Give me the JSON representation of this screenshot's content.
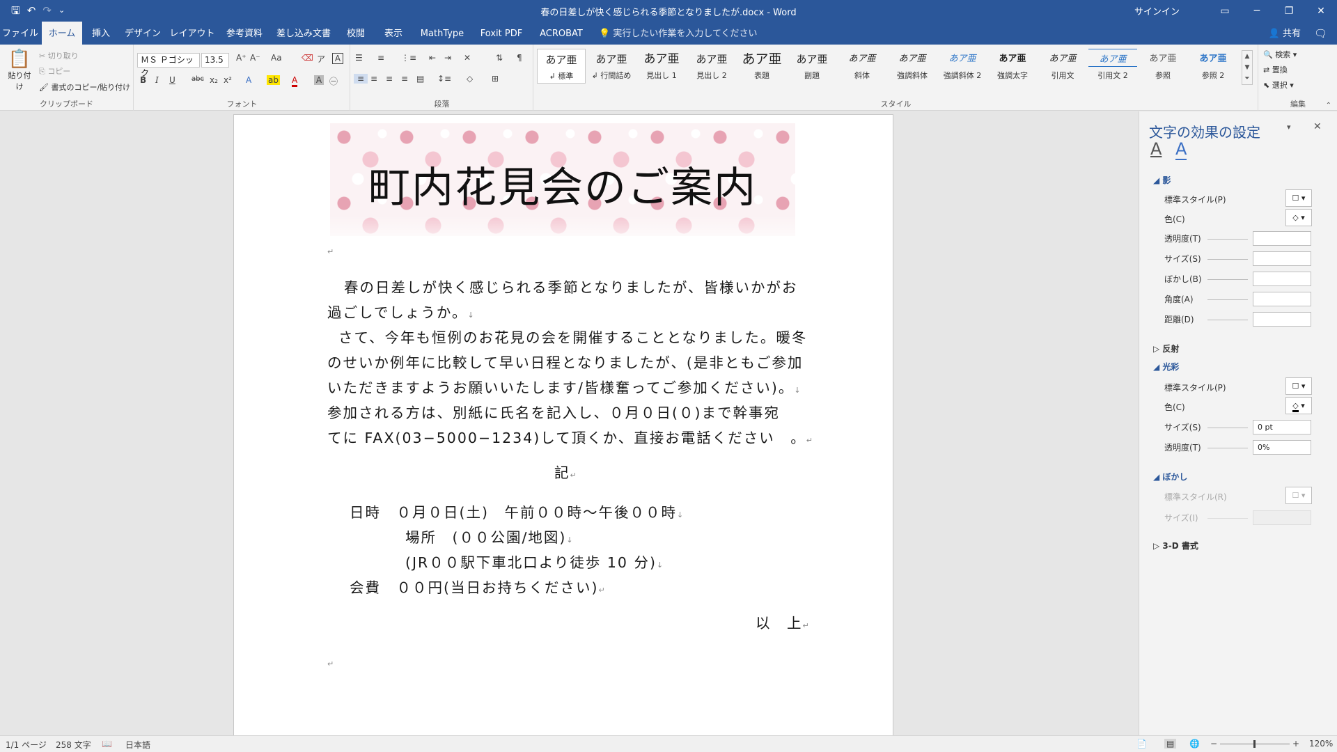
{
  "window": {
    "title": "春の日差しが快く感じられる季節となりましたが.docx  -  Word",
    "signin": "サインイン",
    "minimize": "─",
    "restore": "❐",
    "close": "✕"
  },
  "qat": {
    "save": "🖫",
    "undo": "↶",
    "redo": "↷",
    "customize": "⌄"
  },
  "tabs": [
    "ファイル",
    "ホーム",
    "挿入",
    "デザイン",
    "レイアウト",
    "参考資料",
    "差し込み文書",
    "校閲",
    "表示",
    "MathType",
    "Foxit PDF",
    "ACROBAT"
  ],
  "active_tab": "ホーム",
  "tell_me": "実行したい作業を入力してください",
  "share": "共有",
  "ribbon": {
    "clipboard": {
      "paste": "貼り付け",
      "cut": "切り取り",
      "copy": "コピー",
      "format_painter": "書式のコピー/貼り付け",
      "label": "クリップボード"
    },
    "font": {
      "name": "ＭＳ Ｐゴシック",
      "size": "13.5",
      "label": "フォント",
      "bold": "B",
      "italic": "I",
      "underline": "U",
      "strike": "abc",
      "sub": "x₂",
      "sup": "x²"
    },
    "paragraph": {
      "label": "段落"
    },
    "styles": {
      "label": "スタイル",
      "items": [
        {
          "sample": "あア亜",
          "name": "↲ 標準"
        },
        {
          "sample": "あア亜",
          "name": "↲ 行間詰め"
        },
        {
          "sample": "あア亜",
          "name": "見出し 1"
        },
        {
          "sample": "あア亜",
          "name": "見出し 2"
        },
        {
          "sample": "あア亜",
          "name": "表題"
        },
        {
          "sample": "あア亜",
          "name": "副題"
        },
        {
          "sample": "あア亜",
          "name": "斜体"
        },
        {
          "sample": "あア亜",
          "name": "強調斜体"
        },
        {
          "sample": "あア亜",
          "name": "強調斜体 2"
        },
        {
          "sample": "あア亜",
          "name": "強調太字"
        },
        {
          "sample": "あア亜",
          "name": "引用文"
        },
        {
          "sample": "あア亜",
          "name": "引用文 2"
        },
        {
          "sample": "あア亜",
          "name": "参照"
        },
        {
          "sample": "あア亜",
          "name": "参照 2"
        }
      ]
    },
    "editing": {
      "label": "編集",
      "find": "検索",
      "replace": "置換",
      "select": "選択"
    }
  },
  "document": {
    "banner_title": "町内花見会のご案内",
    "para1_line1": "春の日差しが快く感じられる季節となりましたが、皆様いかがお",
    "para1_line2": "過ごしでしょうか。",
    "para2_line1": "さて、今年も恒例のお花見の会を開催することとなりました。暖冬",
    "para2_line2": "のせいか例年に比較して早い日程となりましたが、(是非ともご参加",
    "para2_line3": "いただきますようお願いいたします/皆様奮ってご参加ください)。",
    "para3_line1": "参加される方は、別紙に氏名を記入し、０月０日(０)まで幹事宛",
    "para3_line2": "てに FAX(03−5000−1234)して頂くか、直接お電話ください　。",
    "ki": "記",
    "date_line": "日時　０月０日(土)　午前００時～午後００時",
    "place_line": "場所　(００公園/地図)",
    "access_line": "(JR００駅下車北口より徒歩 10 分)",
    "fee_line": "会費　００円(当日お持ちください)",
    "closing": "以　上"
  },
  "pane": {
    "title": "文字の効果の設定",
    "shadow": {
      "header": "影",
      "preset": "標準スタイル(P)",
      "color": "色(C)",
      "transparency": "透明度(T)",
      "size": "サイズ(S)",
      "blur": "ぼかし(B)",
      "angle": "角度(A)",
      "distance": "距離(D)"
    },
    "reflection": "反射",
    "glow": {
      "header": "光彩",
      "preset": "標準スタイル(P)",
      "color": "色(C)",
      "size": "サイズ(S)",
      "size_value": "0 pt",
      "transparency": "透明度(T)",
      "transparency_value": "0%"
    },
    "soft_edges": {
      "header": "ぼかし",
      "preset": "標準スタイル(R)",
      "size": "サイズ(I)"
    },
    "three_d": "3-D 書式"
  },
  "status": {
    "page": "1/1 ページ",
    "words": "258 文字",
    "language": "日本語",
    "zoom": "120%"
  },
  "colors": {
    "accent": "#2b579a"
  }
}
